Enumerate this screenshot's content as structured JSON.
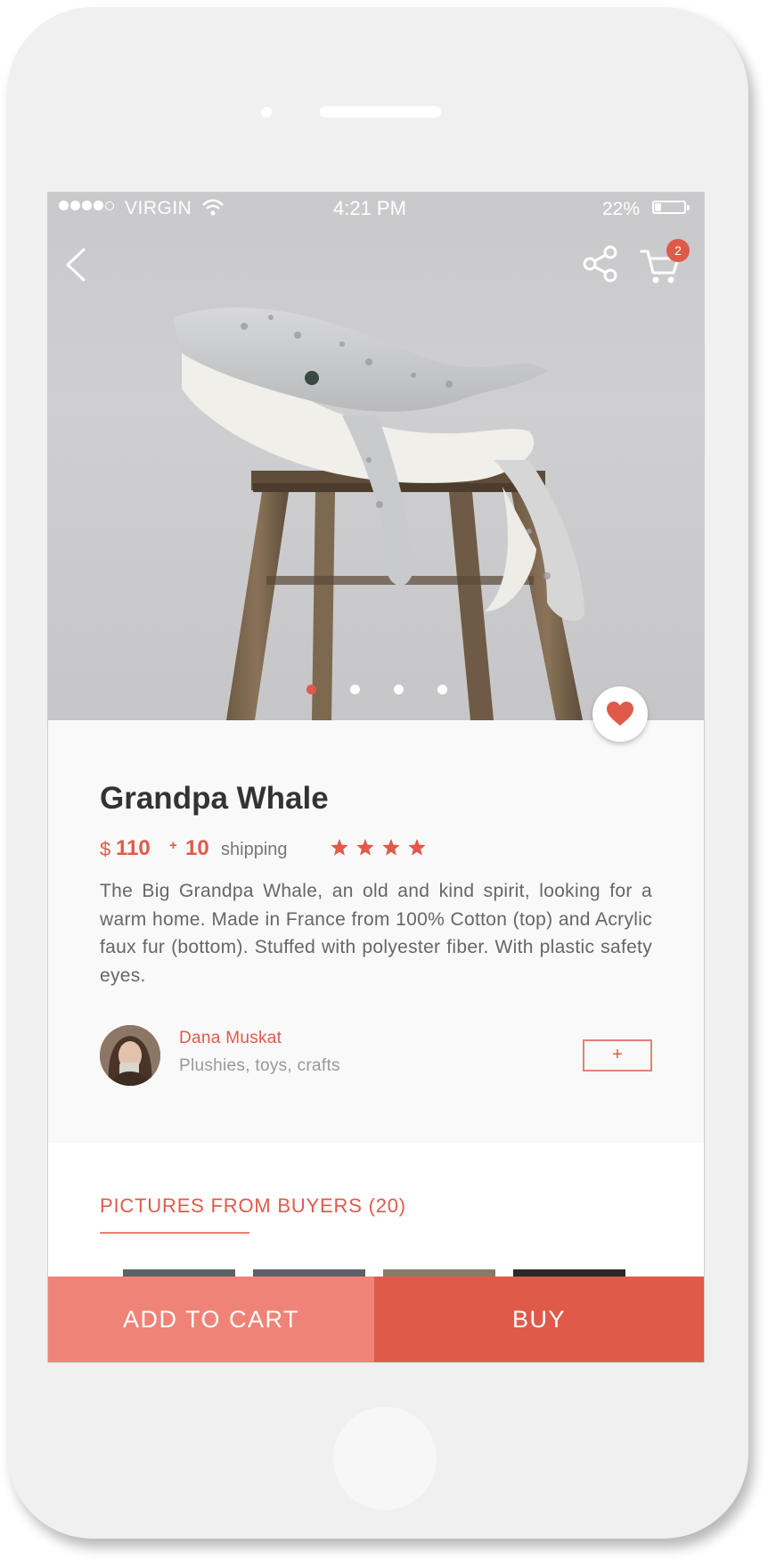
{
  "status_bar": {
    "carrier": "VIRGIN",
    "time": "4:21 PM",
    "battery_percent": "22%",
    "battery_level": 0.22,
    "signal_bars_filled": 4,
    "signal_bars_total": 5
  },
  "header": {
    "back_icon": "chevron-left-icon",
    "share_icon": "share-icon",
    "cart_icon": "cart-icon",
    "cart_count": "2"
  },
  "gallery": {
    "image": "plush grey whale on wooden stool",
    "pages_total": 4,
    "active_page": 1,
    "favorite_icon": "heart-icon"
  },
  "product": {
    "name": "Grandpa Whale",
    "currency": "$",
    "price": "110",
    "shipping_prefix": "+",
    "shipping_cost": "10",
    "shipping_label": "shipping",
    "rating": 4,
    "description": "The Big Grandpa Whale, an old and kind spirit, looking for a warm home. Made in France from 100% Cotton (top) and Acrylic faux fur (bottom). Stuffed with polyester fiber. With plastic safety eyes."
  },
  "seller": {
    "name": "Dana Muskat",
    "tags": "Plushies, toys, crafts",
    "follow_label": "+"
  },
  "buyers": {
    "title": "PICTURES FROM BUYERS (20)"
  },
  "actions": {
    "add_to_cart": "ADD TO CART",
    "buy": "BUY"
  },
  "colors": {
    "accent": "#e05a4a",
    "accent_light": "#f08377"
  }
}
